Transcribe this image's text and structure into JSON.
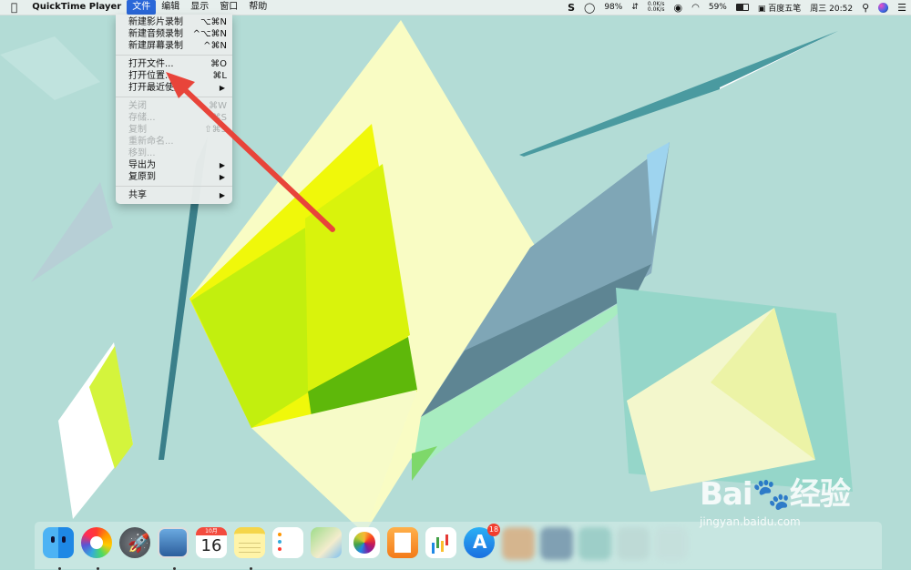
{
  "menubar": {
    "apple": "",
    "app_name": "QuickTime Player",
    "menus": [
      "文件",
      "编辑",
      "显示",
      "窗口",
      "帮助"
    ],
    "status": {
      "battery_circle": "98%",
      "net_up": "0.0K/s",
      "net_down": "0.0K/s",
      "battery_percent": "59%",
      "input_method": "百度五笔",
      "datetime": "周三 20:52"
    }
  },
  "file_menu": {
    "items": [
      {
        "label": "新建影片录制",
        "shortcut": "⌥⌘N",
        "disabled": false
      },
      {
        "label": "新建音频录制",
        "shortcut": "^⌥⌘N",
        "disabled": false
      },
      {
        "label": "新建屏幕录制",
        "shortcut": "^⌘N",
        "disabled": false
      },
      {
        "label": "打开文件...",
        "shortcut": "⌘O",
        "disabled": false
      },
      {
        "label": "打开位置...",
        "shortcut": "⌘L",
        "disabled": false
      },
      {
        "label": "打开最近使用",
        "shortcut": "",
        "disabled": false,
        "submenu": true
      },
      {
        "label": "关闭",
        "shortcut": "⌘W",
        "disabled": true
      },
      {
        "label": "存储...",
        "shortcut": "⌘S",
        "disabled": true
      },
      {
        "label": "复制",
        "shortcut": "⇧⌘S",
        "disabled": true
      },
      {
        "label": "重新命名...",
        "shortcut": "",
        "disabled": true
      },
      {
        "label": "移到...",
        "shortcut": "",
        "disabled": true
      },
      {
        "label": "导出为",
        "shortcut": "",
        "disabled": false,
        "submenu": true
      },
      {
        "label": "复原到",
        "shortcut": "",
        "disabled": false,
        "submenu": true
      },
      {
        "label": "共享",
        "shortcut": "",
        "disabled": false,
        "submenu": true
      }
    ],
    "submenu_arrow": "▶"
  },
  "dock": {
    "calendar_month": "10月",
    "calendar_day": "16",
    "launchpad_glyph": "🚀",
    "appstore_glyph": "A",
    "appstore_badge": "18"
  },
  "watermark": {
    "brand": "Bai🐾经验",
    "url": "jingyan.baidu.com"
  },
  "colors": {
    "menu_highlight": "#2a67d8",
    "annotation_arrow": "#e8443a",
    "wallpaper_bg": "#b2dcd6"
  }
}
